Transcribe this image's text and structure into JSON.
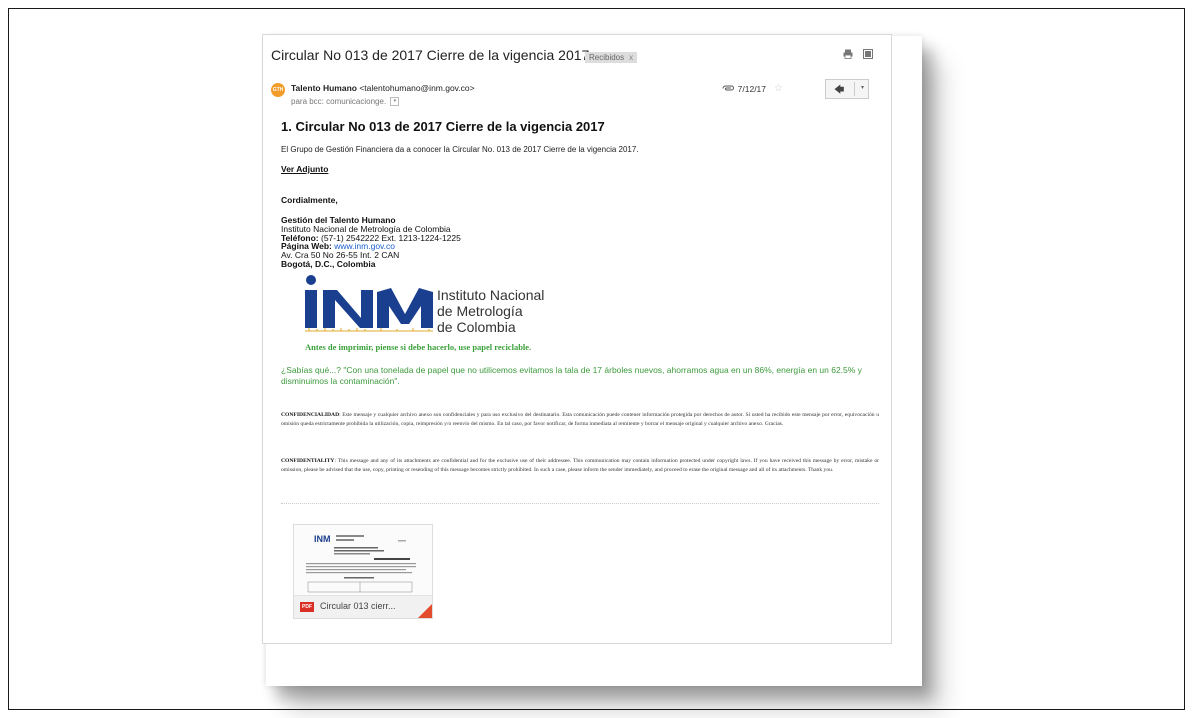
{
  "email": {
    "subject": "Circular No 013 de 2017 Cierre de la vigencia 2017",
    "label": "Recibidos",
    "label_close": "x",
    "avatar_text": "GTH",
    "sender_name": "Talento Humano",
    "sender_email": "<talentohumano@inm.gov.co>",
    "recipient": "para bcc: comunicacionge.",
    "date": "7/12/17"
  },
  "body": {
    "headline": "1. Circular No 013  de 2017 Cierre de la vigencia 2017",
    "intro": "El Grupo de Gestión Financiera da a conocer la Circular No. 013 de 2017 Cierre de la vigencia 2017.",
    "ver_adjunto": "Ver Adjunto",
    "closing": "Cordialmente,",
    "signature": {
      "dept": "Gestión del Talento Humano",
      "institute": "Instituto Nacional de Metrología de Colombia",
      "phone_label": "Teléfono:",
      "phone": " (57-1) 2542222 Ext. 1213-1224-1225",
      "web_label": "Página Web:",
      "web": "www.inm.gov.co",
      "address": "Av. Cra 50 No 26-55 Int. 2 CAN",
      "city": "Bogotá, D.C., Colombia"
    },
    "logo": {
      "letters": "INM",
      "line1": "Instituto Nacional",
      "line2": "de Metrología",
      "line3": "de Colombia"
    },
    "eco_note": "Antes de imprimir, piense si debe hacerlo, use papel reciclable.",
    "sabias": "¿Sabías qué...? \"Con una tonelada de papel que no utilicemos evitamos la tala de 17 árboles nuevos, ahorramos agua en un 86%, energía en un 62.5% y disminuimos la contaminación\".",
    "conf_es_label": "CONFIDENCIALIDAD",
    "conf_es": ": Este mensaje y cualquier archivo anexo son confidenciales y para uso exclusivo del destinatario. Esta comunicación puede contener información protegida por derechos de autor. Si usted ha recibido este mensaje por error, equivocación u omisión queda estrictamente prohibida la utilización, copia, reimpresión y/o reenvío del mismo. En tal caso, por favor notificar, de forma inmediata al remitente y borrar el mensaje original y cualquier archivo anexo. Gracias.",
    "conf_en_label": "CONFIDENTIALITY",
    "conf_en": ": This message and any of its attachments are confidential and for the exclusive use of their addressee. This communication may contain information protected under copyright laws. If you have received this message by error, mistake or omission, please be advised that the use, copy, printing or resending of this message becomes strictly prohibited. In such a case, please inform the sender immediately, and proceed to erase the original message and all of its attachments. Thank you."
  },
  "attachment": {
    "type": "PDF",
    "name": "Circular 013 cierr..."
  },
  "colors": {
    "accent_green": "#3c9a3c",
    "pdf_red": "#d93025",
    "logo_blue": "#1b3f8f",
    "avatar_orange": "#f39c2a"
  }
}
